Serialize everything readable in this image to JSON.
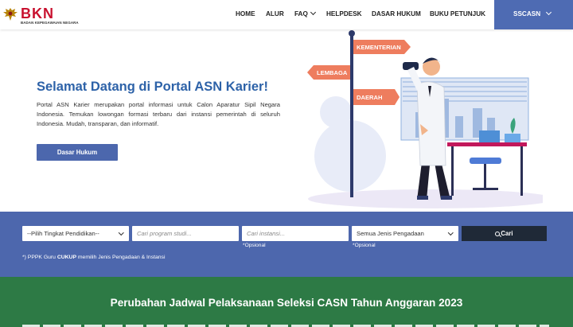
{
  "header": {
    "logo_text": "BKN",
    "logo_subtitle": "BADAN KEPEGAWAIAN NEGARA",
    "nav": [
      {
        "label": "HOME"
      },
      {
        "label": "ALUR"
      },
      {
        "label": "FAQ"
      },
      {
        "label": "HELPDESK"
      },
      {
        "label": "DASAR HUKUM"
      },
      {
        "label": "BUKU PETUNJUK"
      }
    ],
    "sscasn_label": "SSCASN"
  },
  "hero": {
    "title": "Selamat Datang di Portal ASN Karier!",
    "text": "Portal ASN Karier merupakan portal informasi untuk Calon Aparatur Sipil Negara Indonesia. Temukan lowongan formasi terbaru dari instansi pemerintah di seluruh Indonesia. Mudah, transparan, dan informatif.",
    "button_label": "Dasar Hukum",
    "signs": [
      "KEMENTERIAN",
      "LEMBAGA",
      "DAERAH"
    ]
  },
  "search": {
    "pendidikan_value": "--Pilih Tingkat Pendidikan--",
    "prodi_placeholder": "Cari program studi...",
    "instansi_placeholder": "Cari instansi...",
    "pengadaan_value": "Semua Jenis Pengadaan",
    "cari_label": "Cari",
    "opsional_label": "*Opsional",
    "note_prefix": "*) PPPK Guru ",
    "note_bold": "CUKUP",
    "note_suffix": " memilih Jenis Pengadaan & Instansi"
  },
  "announcement": {
    "title": "Perubahan Jadwal Pelaksanaan Seleksi CASN Tahun Anggaran 2023"
  },
  "colors": {
    "primary_blue": "#4e6bb3",
    "title_blue": "#2d62a8",
    "green": "#2d7a45",
    "sign_orange": "#ee7d5e",
    "dark_button": "#1f2937",
    "logo_red": "#c8102e"
  }
}
